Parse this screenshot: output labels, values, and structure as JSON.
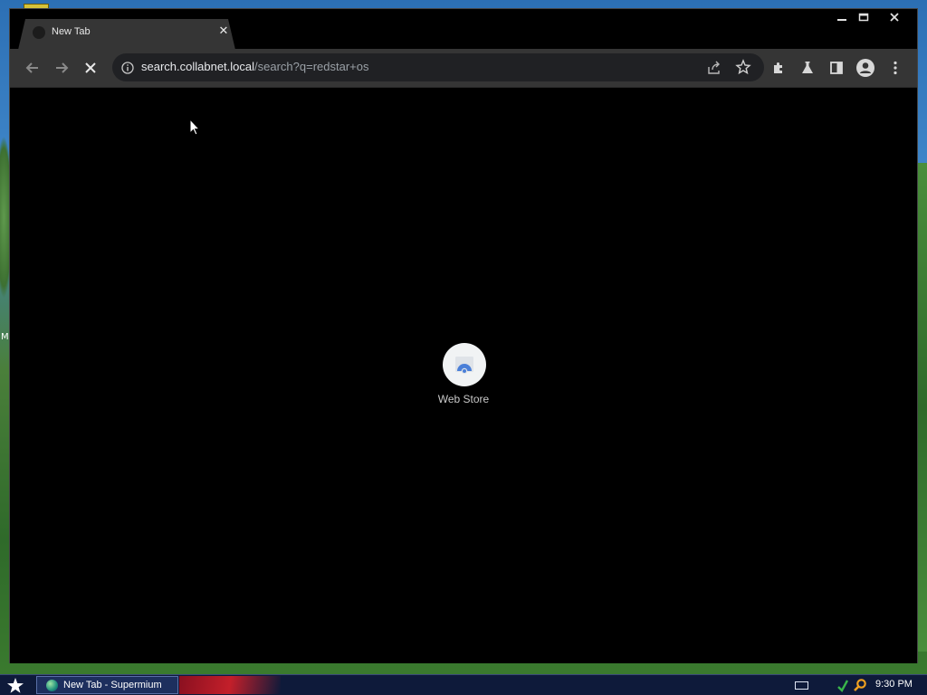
{
  "window": {
    "tab_title": "New Tab",
    "controls": {
      "minimize": "–",
      "maximize": "□",
      "close": "✕"
    }
  },
  "toolbar": {
    "url_host": "search.collabnet.local",
    "url_path": "/search?q=redstar+os",
    "icons": [
      "back-icon",
      "forward-icon",
      "stop-icon",
      "info-icon",
      "share-icon",
      "star-icon",
      "extensions-icon",
      "labs-icon",
      "side-panel-icon",
      "profile-icon",
      "menu-icon"
    ]
  },
  "content": {
    "shortcut_label": "Web Store"
  },
  "desktop": {
    "edge_letter": "M"
  },
  "taskbar": {
    "task_label": "New Tab - Supermium",
    "clock": "9:30 PM"
  }
}
